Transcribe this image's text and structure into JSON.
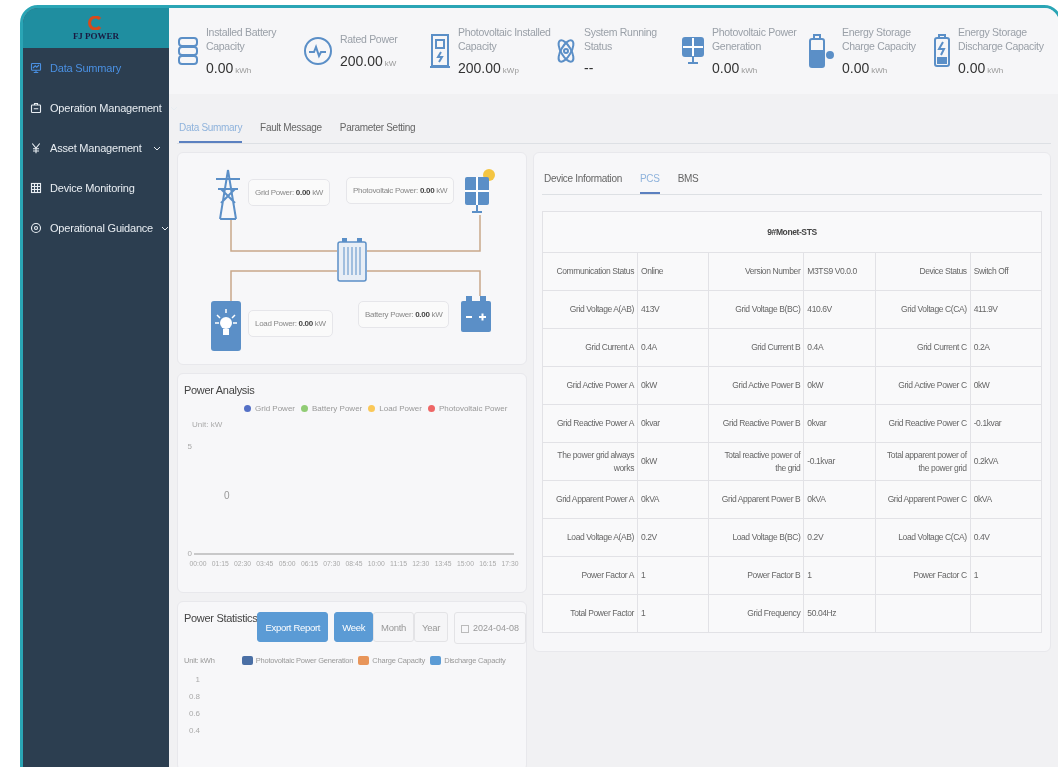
{
  "logo": {
    "brand": "FJ POWER"
  },
  "sidebar": {
    "items": [
      {
        "label": "Data Summary",
        "selected": true,
        "has_submenu": false
      },
      {
        "label": "Operation Management",
        "selected": false,
        "has_submenu": true
      },
      {
        "label": "Asset Management",
        "selected": false,
        "has_submenu": true
      },
      {
        "label": "Device Monitoring",
        "selected": false,
        "has_submenu": false
      },
      {
        "label": "Operational Guidance",
        "selected": false,
        "has_submenu": true
      }
    ]
  },
  "stats": [
    {
      "title": "Installed Battery Capacity",
      "value": "0.00",
      "unit": "kWh"
    },
    {
      "title": "Rated Power",
      "value": "200.00",
      "unit": "kW"
    },
    {
      "title": "Photovoltaic Installed Capacity",
      "value": "200.00",
      "unit": "kWp"
    },
    {
      "title": "System Running Status",
      "value": "--"
    },
    {
      "title": "Photovoltaic Power Generation",
      "value": "0.00",
      "unit": "kWh"
    },
    {
      "title": "Energy Storage Charge Capacity",
      "value": "0.00",
      "unit": "kWh"
    },
    {
      "title": "Energy Storage Discharge Capacity",
      "value": "0.00",
      "unit": "kWh"
    }
  ],
  "tabs": [
    {
      "label": "Data Summary",
      "selected": true
    },
    {
      "label": "Fault Message",
      "selected": false
    },
    {
      "label": "Parameter Setting",
      "selected": false
    }
  ],
  "flow": {
    "grid": "Grid Power: **0.00** kW",
    "photovoltaic": "Photovoltaic Power: **0.00** kW",
    "load": "Load Power: **0.00** kW",
    "battery": "Battery Power: **0.00** kW"
  },
  "power_analysis": {
    "title": "Power Analysis",
    "chart_data": {
      "type": "line",
      "ylabel": "Unit: kW",
      "categories": [
        "00:00",
        "01:15",
        "02:30",
        "03:45",
        "05:00",
        "06:15",
        "07:30",
        "08:45",
        "10:00",
        "11:15",
        "12:30",
        "13:45",
        "15:00",
        "16:15",
        "17:30"
      ],
      "ylim": [
        0,
        5
      ],
      "yticks": [
        0,
        5
      ],
      "annotations": [
        {
          "text": "0"
        }
      ],
      "series": [
        {
          "name": "Grid Power",
          "color": "#5470c6",
          "values": [
            null,
            null,
            null,
            null,
            null,
            null,
            null,
            null,
            null,
            null,
            null,
            null,
            null,
            null,
            null
          ]
        },
        {
          "name": "Battery Power",
          "color": "#91cc75",
          "values": [
            null,
            null,
            null,
            null,
            null,
            null,
            null,
            null,
            null,
            null,
            null,
            null,
            null,
            null,
            null
          ]
        },
        {
          "name": "Load Power",
          "color": "#fac858",
          "values": [
            null,
            null,
            null,
            null,
            null,
            null,
            null,
            null,
            null,
            null,
            null,
            null,
            null,
            null,
            null
          ]
        },
        {
          "name": "Photovoltaic Power",
          "color": "#ee6666",
          "values": [
            null,
            null,
            null,
            null,
            null,
            null,
            null,
            null,
            null,
            null,
            null,
            null,
            null,
            null,
            null
          ]
        }
      ]
    }
  },
  "power_statistics": {
    "title": "Power Statistics",
    "export_button": "Export Report",
    "periods": [
      {
        "label": "Week",
        "selected": true
      },
      {
        "label": "Month",
        "selected": false
      },
      {
        "label": "Year",
        "selected": false
      }
    ],
    "date": "2024-04-08",
    "unit": "Unit: kWh",
    "legend": [
      {
        "name": "Photovoltaic Power Generation",
        "color": "#4a6fa5"
      },
      {
        "name": "Charge Capacity",
        "color": "#e8955a"
      },
      {
        "name": "Discharge Capacity",
        "color": "#5b9bd5"
      }
    ],
    "y_axis_labels": [
      "1",
      "0.8",
      "0.6",
      "0.4"
    ]
  },
  "device": {
    "tabs": [
      {
        "label": "Device Information",
        "selected": false
      },
      {
        "label": "PCS",
        "selected": true
      },
      {
        "label": "BMS",
        "selected": false
      }
    ],
    "title": "9#Monet-STS",
    "rows": [
      [
        [
          "Communication Status",
          "Online"
        ],
        [
          "Version Number",
          "M3TS9 V0.0.0"
        ],
        [
          "Device Status",
          "Switch Off"
        ]
      ],
      [
        [
          "Grid Voltage A(AB)",
          "413V"
        ],
        [
          "Grid Voltage B(BC)",
          "410.6V"
        ],
        [
          "Grid Voltage C(CA)",
          "411.9V"
        ]
      ],
      [
        [
          "Grid Current A",
          "0.4A"
        ],
        [
          "Grid Current B",
          "0.4A"
        ],
        [
          "Grid Current C",
          "0.2A"
        ]
      ],
      [
        [
          "Grid Active Power A",
          "0kW"
        ],
        [
          "Grid Active Power B",
          "0kW"
        ],
        [
          "Grid Active Power C",
          "0kW"
        ]
      ],
      [
        [
          "Grid Reactive Power A",
          "0kvar"
        ],
        [
          "Grid Reactive Power B",
          "0kvar"
        ],
        [
          "Grid Reactive Power C",
          "-0.1kvar"
        ]
      ],
      [
        [
          "The power grid always works",
          "0kW"
        ],
        [
          "Total reactive power of the grid",
          "-0.1kvar"
        ],
        [
          "Total apparent power of the power grid",
          "0.2kVA"
        ]
      ],
      [
        [
          "Grid Apparent Power A",
          "0kVA"
        ],
        [
          "Grid Apparent Power B",
          "0kVA"
        ],
        [
          "Grid Apparent Power C",
          "0kVA"
        ]
      ],
      [
        [
          "Load Voltage A(AB)",
          "0.2V"
        ],
        [
          "Load Voltage B(BC)",
          "0.2V"
        ],
        [
          "Load Voltage C(CA)",
          "0.4V"
        ]
      ],
      [
        [
          "Power Factor A",
          "1"
        ],
        [
          "Power Factor B",
          "1"
        ],
        [
          "Power Factor C",
          "1"
        ]
      ],
      [
        [
          "Total Power Factor",
          "1"
        ],
        [
          "Grid Frequency",
          "50.04Hz"
        ]
      ]
    ]
  }
}
